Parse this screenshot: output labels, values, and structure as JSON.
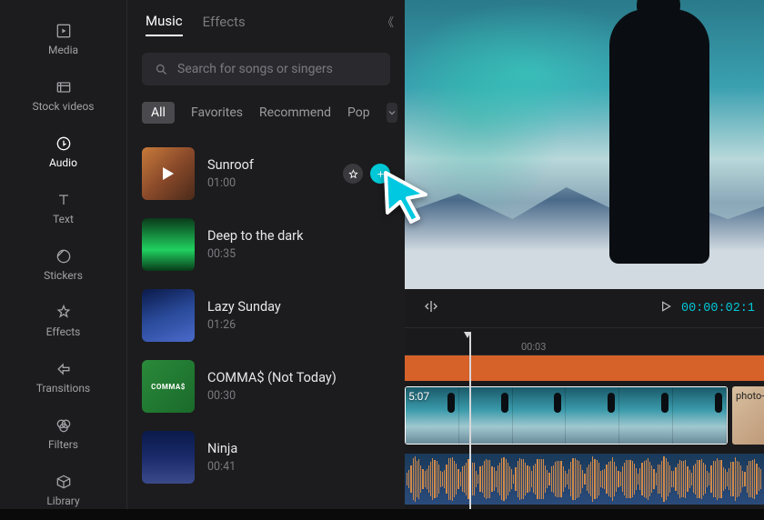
{
  "rail": {
    "items": [
      {
        "id": "media",
        "label": "Media"
      },
      {
        "id": "stock",
        "label": "Stock videos"
      },
      {
        "id": "audio",
        "label": "Audio",
        "active": true
      },
      {
        "id": "text",
        "label": "Text"
      },
      {
        "id": "stickers",
        "label": "Stickers"
      },
      {
        "id": "effects",
        "label": "Effects"
      },
      {
        "id": "transitions",
        "label": "Transitions"
      },
      {
        "id": "filters",
        "label": "Filters"
      },
      {
        "id": "library",
        "label": "Library"
      }
    ]
  },
  "panel": {
    "tabs": [
      {
        "id": "music",
        "label": "Music",
        "active": true
      },
      {
        "id": "effects",
        "label": "Effects"
      }
    ],
    "search_placeholder": "Search for songs or singers",
    "chips": [
      {
        "label": "All",
        "active": true
      },
      {
        "label": "Favorites"
      },
      {
        "label": "Recommend"
      },
      {
        "label": "Pop"
      }
    ],
    "songs": [
      {
        "title": "Sunroof",
        "dur": "01:00",
        "selected": true
      },
      {
        "title": "Deep to the dark",
        "dur": "00:35"
      },
      {
        "title": "Lazy Sunday",
        "dur": "01:26"
      },
      {
        "title": "COMMA$ (Not Today)",
        "dur": "00:30"
      },
      {
        "title": "Ninja",
        "dur": "00:41"
      }
    ]
  },
  "controls": {
    "time": "00:00:02:1"
  },
  "timeline": {
    "ruler_mark": "00:03",
    "clip_vid_label": "5:07",
    "clip_photo_label": "photo-"
  }
}
